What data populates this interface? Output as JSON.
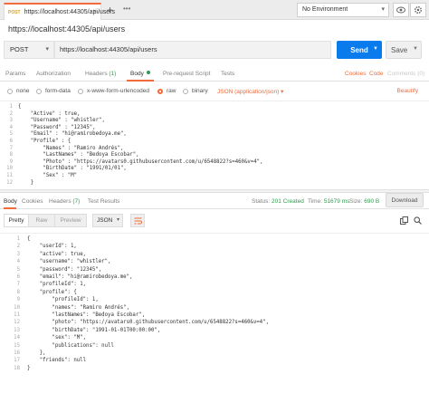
{
  "tab": {
    "method": "POST",
    "url": "https://localhost:44305/api/users"
  },
  "toolbar": {
    "environment": "No Environment"
  },
  "request": {
    "title": "https://localhost:44305/api/users",
    "method": "POST",
    "url": "https://localhost:44305/api/users",
    "send_label": "Send",
    "save_label": "Save"
  },
  "request_tabs": [
    {
      "label": "Params",
      "active": false
    },
    {
      "label": "Authorization",
      "active": false
    },
    {
      "label": "Headers",
      "count": "(1)",
      "active": false
    },
    {
      "label": "Body",
      "active": true
    },
    {
      "label": "Pre-request Script",
      "active": false
    },
    {
      "label": "Tests",
      "active": false
    }
  ],
  "request_tabs_right": {
    "cookies": "Cookies",
    "code": "Code",
    "comments": "Comments (0)"
  },
  "body_options": [
    {
      "label": "none",
      "selected": false
    },
    {
      "label": "form-data",
      "selected": false
    },
    {
      "label": "x-www-form-urlencoded",
      "selected": false
    },
    {
      "label": "raw",
      "selected": true
    },
    {
      "label": "binary",
      "selected": false
    }
  ],
  "body_format": "JSON (application/json)",
  "beautify_label": "Beautify",
  "request_body": [
    {
      "n": "1",
      "t": "{"
    },
    {
      "n": "2",
      "t": "    \"Active\" : true,"
    },
    {
      "n": "3",
      "t": "    \"Username\" : \"whistler\","
    },
    {
      "n": "4",
      "t": "    \"Password\" : \"12345\","
    },
    {
      "n": "5",
      "t": "    \"Email\" : \"hi@ramirobedoya.me\","
    },
    {
      "n": "6",
      "t": "    \"Profile\" : {"
    },
    {
      "n": "7",
      "t": "        \"Names\" : \"Ramiro Andrés\","
    },
    {
      "n": "8",
      "t": "        \"LastNames\" : \"Bedoya Escobar\","
    },
    {
      "n": "9",
      "t": "        \"Photo\" : \"https://avatars0.githubusercontent.com/u/6548822?s=460&v=4\","
    },
    {
      "n": "10",
      "t": "        \"BirthDate\" : \"1991/01/01\","
    },
    {
      "n": "11",
      "t": "        \"Sex\" : \"M\""
    },
    {
      "n": "12",
      "t": "    }"
    }
  ],
  "response_tabs": [
    {
      "label": "Body",
      "active": true
    },
    {
      "label": "Cookies",
      "active": false
    },
    {
      "label": "Headers",
      "count": "(7)",
      "active": false
    },
    {
      "label": "Test Results",
      "active": false
    }
  ],
  "response_status": {
    "status_label": "Status:",
    "status_value": "201 Created",
    "time_label": "Time:",
    "time_value": "51679 ms",
    "size_label": "Size:",
    "size_value": "690 B",
    "download_label": "Download"
  },
  "response_view": {
    "modes": [
      "Pretty",
      "Raw",
      "Preview"
    ],
    "active_mode": "Pretty",
    "format": "JSON"
  },
  "response_body": [
    {
      "n": "1",
      "t": "{"
    },
    {
      "n": "2",
      "t": "    \"userId\": 1,"
    },
    {
      "n": "3",
      "t": "    \"active\": true,"
    },
    {
      "n": "4",
      "t": "    \"username\": \"whistler\","
    },
    {
      "n": "5",
      "t": "    \"password\": \"12345\","
    },
    {
      "n": "6",
      "t": "    \"email\": \"hi@ramirobedoya.me\","
    },
    {
      "n": "7",
      "t": "    \"profileId\": 1,"
    },
    {
      "n": "8",
      "t": "    \"profile\": {"
    },
    {
      "n": "9",
      "t": "        \"profileId\": 1,"
    },
    {
      "n": "10",
      "t": "        \"names\": \"Ramiro Andrés\","
    },
    {
      "n": "11",
      "t": "        \"lastNames\": \"Bedoya Escobar\","
    },
    {
      "n": "12",
      "t": "        \"photo\": \"https://avatars0.githubusercontent.com/u/6548822?s=460&v=4\","
    },
    {
      "n": "13",
      "t": "        \"birthDate\": \"1991-01-01T00:00:00\","
    },
    {
      "n": "14",
      "t": "        \"sex\": \"M\","
    },
    {
      "n": "15",
      "t": "        \"publications\": null"
    },
    {
      "n": "16",
      "t": "    },"
    },
    {
      "n": "17",
      "t": "    \"friends\": null"
    },
    {
      "n": "18",
      "t": "}"
    }
  ],
  "colors": {
    "accent": "#f26b3a",
    "send": "#097bed",
    "status_ok": "#2e9c4e"
  }
}
